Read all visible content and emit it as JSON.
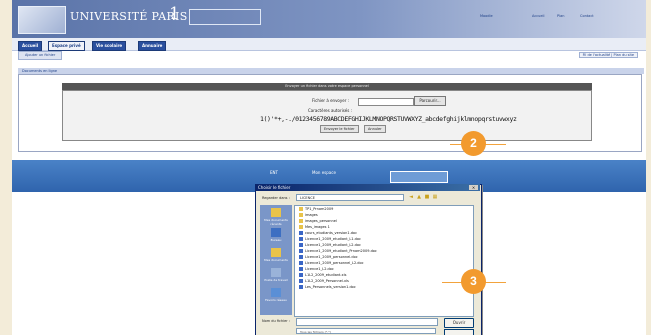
{
  "header": {
    "university": "UNIVERSITÉ PARIS",
    "number": "1",
    "top_links": [
      "Accueil",
      "Plan",
      "Contact"
    ],
    "user": "Moodle"
  },
  "tabs": [
    "Accueil",
    "Espace privé",
    "Vie scolaire",
    "Annuaire"
  ],
  "subtab": "Ajouter un fichier",
  "right_link": "Fil de l'actualité | Plan du site",
  "section_title": "Documents en ligne",
  "upload_panel": {
    "header": "Envoyer un fichier dans votre espace personnel",
    "file_label": "Fichier à envoyer :",
    "browse_label": "Parcourir...",
    "allowed_label": "Caractères autorisés :",
    "allowed_chars": "1()'*+,-./0123456789ABCDEFGHIJKLMNOPQRSTUVWXYZ_abcdefghijklmnopqrstuvwxyz",
    "send_label": "Envoyer le fichier",
    "cancel_label": "Annuler"
  },
  "second_window": {
    "tab1": "ENT",
    "tab2": "Mon espace"
  },
  "dialog": {
    "title": "Choisir le fichier",
    "close": "×",
    "lookin_label": "Regarder dans :",
    "lookin_value": "LICENCE",
    "places": [
      "Mes documents récents",
      "Bureau",
      "Mes documents",
      "Poste de travail",
      "Favoris réseau"
    ],
    "files": [
      {
        "name": "TP1_Prnom2009",
        "kind": "folder"
      },
      {
        "name": "images",
        "kind": "folder"
      },
      {
        "name": "images_personnel",
        "kind": "folder"
      },
      {
        "name": "Mes_images 1",
        "kind": "folder"
      },
      {
        "name": "cours_etudiants_version1.doc",
        "kind": "doc"
      },
      {
        "name": "Licence1_2009_etudiant_L1.doc",
        "kind": "doc"
      },
      {
        "name": "Licence1_2009_etudiant_L2.doc",
        "kind": "doc"
      },
      {
        "name": "Licence1_2009_etudiant_Prnom2009.doc",
        "kind": "doc"
      },
      {
        "name": "Licence1_2009_personnel.doc",
        "kind": "doc"
      },
      {
        "name": "Licence1_2009_personnel_L2.doc",
        "kind": "doc"
      },
      {
        "name": "Licence1_L2.doc",
        "kind": "doc"
      },
      {
        "name": "L1L2_2009_etudiant.xls",
        "kind": "doc"
      },
      {
        "name": "L1L2_2009_Personnel.xls",
        "kind": "doc"
      },
      {
        "name": "Les_Personnels_version1.doc",
        "kind": "doc"
      }
    ],
    "filename_label": "Nom du fichier :",
    "filetype_label": "Fichiers de type :",
    "filetype_value": "Tous les fichiers (*.*)",
    "open_label": "Ouvrir",
    "cancel_label": "Annuler"
  },
  "callouts": [
    "2",
    "3"
  ],
  "colors": {
    "accent": "#f29a2e",
    "banner": "#5a73a8",
    "tab": "#2a4f9e"
  }
}
